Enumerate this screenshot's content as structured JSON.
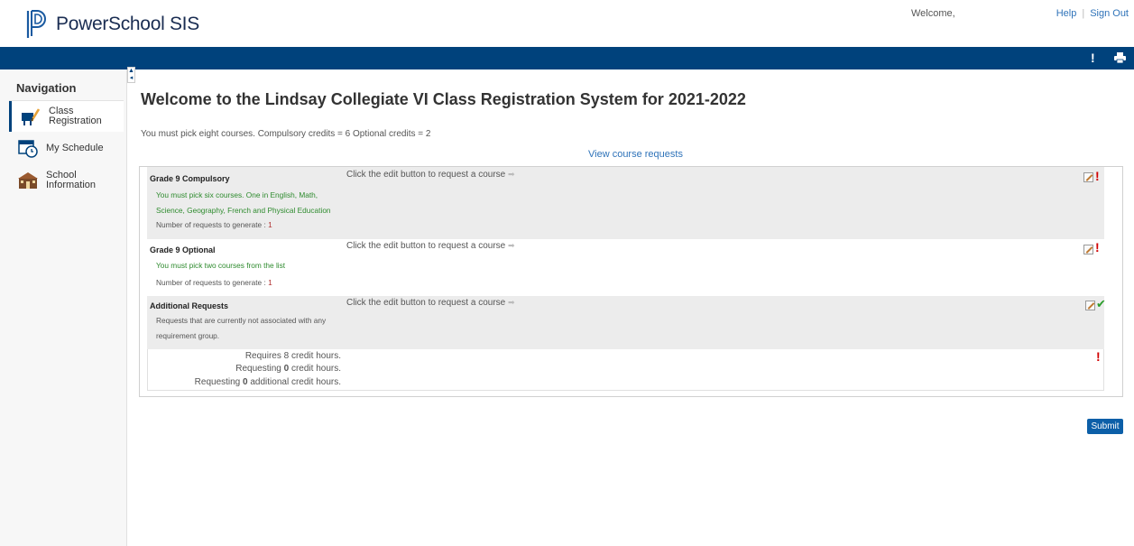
{
  "header": {
    "brand": "PowerSchool SIS",
    "welcome": "Welcome,",
    "help": "Help",
    "separator": "|",
    "signout": "Sign Out",
    "bar_icons": [
      "alert-icon",
      "print-icon"
    ]
  },
  "sidebar": {
    "heading": "Navigation",
    "items": [
      {
        "line1": "Class",
        "line2": "Registration",
        "icon": "class-registration-icon",
        "active": true
      },
      {
        "line1": "My Schedule",
        "line2": "",
        "icon": "calendar-clock-icon",
        "active": false
      },
      {
        "line1": "School",
        "line2": "Information",
        "icon": "school-building-icon",
        "active": false
      }
    ]
  },
  "main": {
    "title": "Welcome to the Lindsay Collegiate VI Class Registration System for 2021-2022",
    "intro": "You must pick eight courses. Compulsory credits = 6 Optional credits = 2",
    "view_link": "View course requests",
    "click_text": "Click the edit button to request a course",
    "groups": [
      {
        "name": "Grade 9 Compulsory",
        "desc_lines": [
          "You must pick six courses. One in English, Math,",
          "Science, Geography, French and Physical Education"
        ],
        "num_label": "Number of requests to generate : ",
        "num": "1",
        "status": "incomplete"
      },
      {
        "name": "Grade 9 Optional",
        "desc_lines": [
          "You must pick two courses from the list"
        ],
        "num_label": "Number of requests to generate : ",
        "num": "1",
        "status": "incomplete"
      },
      {
        "name": "Additional Requests",
        "desc_lines": [
          "Requests that are currently not associated with any",
          "requirement group."
        ],
        "status": "complete"
      }
    ],
    "credits": {
      "requires": "Requires 8 credit hours.",
      "requesting_pre": "Requesting ",
      "requesting_val": "0",
      "requesting_post": " credit hours.",
      "additional_pre": "Requesting ",
      "additional_val": "0",
      "additional_post": " additional credit hours."
    },
    "submit": "Submit"
  },
  "colors": {
    "brand_blue": "#00427c",
    "link_blue": "#2f73b9",
    "green_text": "#2e8b2e",
    "alert_red": "#d10000"
  }
}
